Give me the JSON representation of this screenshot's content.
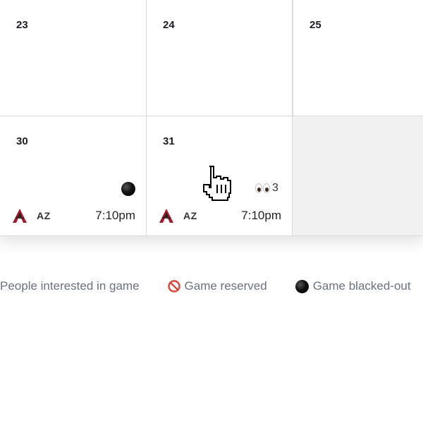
{
  "calendar": {
    "rows": [
      [
        {
          "day": "23"
        },
        {
          "day": "24"
        },
        {
          "day": "25"
        }
      ],
      [
        {
          "day": "30",
          "game": {
            "team": "AZ",
            "time": "7:10pm",
            "status_icon": "blackout-dot-icon"
          }
        },
        {
          "day": "31",
          "game": {
            "team": "AZ",
            "time": "7:10pm",
            "interest_count": "3",
            "status_icon": "eyes-icon"
          }
        },
        {
          "empty": true
        }
      ]
    ]
  },
  "legend": {
    "items": [
      {
        "icon": "eyes-icon",
        "label": "People interested in game"
      },
      {
        "icon": "prohibited-icon",
        "label": "Game reserved"
      },
      {
        "icon": "blackout-dot-icon",
        "label": "Game blacked-out"
      }
    ]
  },
  "colors": {
    "logo_red": "#A71930",
    "logo_dark": "#2B1B17",
    "empty_cell": "#f1f1f1",
    "legend_text": "#6b7280"
  },
  "cursor": {
    "type": "pointer-hand-icon"
  }
}
